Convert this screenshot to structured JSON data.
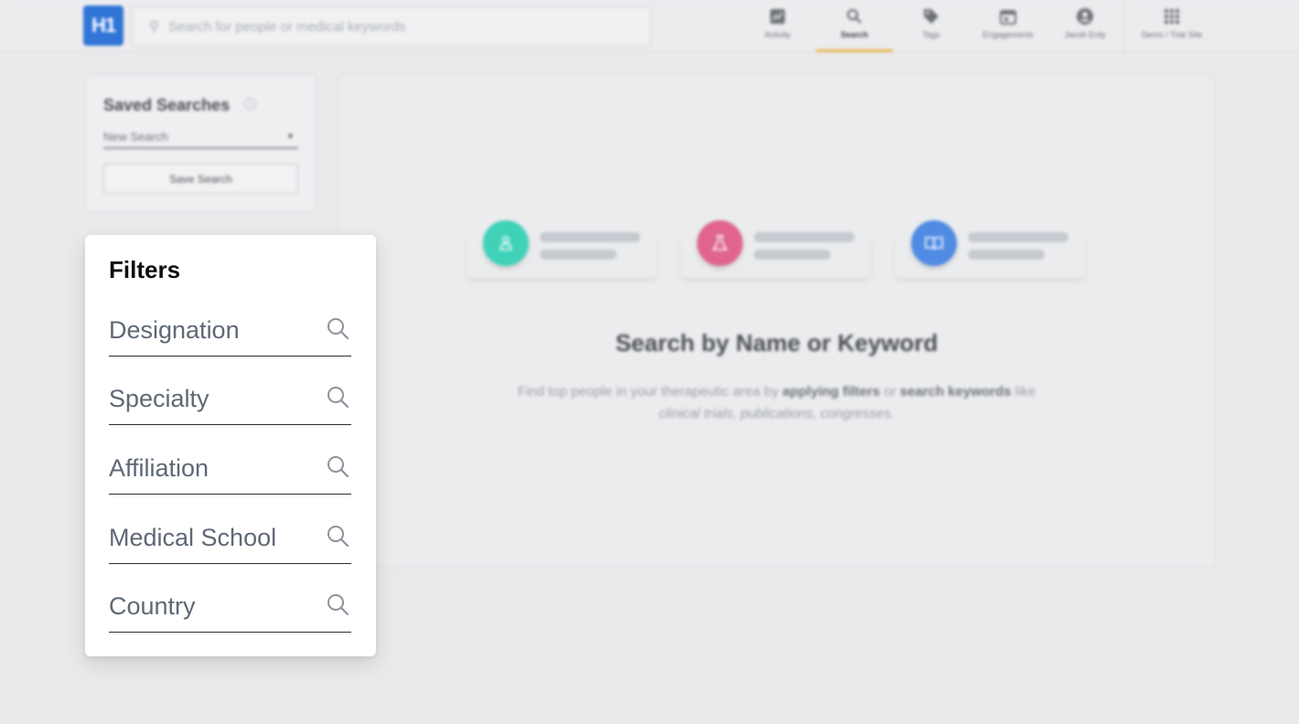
{
  "app": {
    "logo_text": "H1",
    "brand_color": "#2f74d6"
  },
  "search": {
    "placeholder": "Search for people or medical keywords"
  },
  "nav": {
    "items": [
      {
        "label": "Activity",
        "icon": "activity-icon"
      },
      {
        "label": "Search",
        "icon": "search-icon",
        "active": true
      },
      {
        "label": "Tags",
        "icon": "tag-icon"
      },
      {
        "label": "Engagements",
        "icon": "calendar-icon"
      },
      {
        "label": "Jacob Erdy",
        "icon": "account-icon"
      },
      {
        "label": "Demo / Trial Site",
        "icon": "apps-grid-icon"
      }
    ],
    "active_indicator_color": "#e8b44a"
  },
  "saved_searches": {
    "title": "Saved Searches",
    "selected": "New Search",
    "save_button": "Save Search"
  },
  "empty_state": {
    "title": "Search by Name or Keyword",
    "desc_prefix": "Find top people in your therapeutic area by ",
    "desc_bold1": "applying filters",
    "desc_mid": " or ",
    "desc_bold2": "search keywords",
    "desc_suffix": " like",
    "desc_line2": "clinical trials, publications, congresses.",
    "cards": [
      {
        "icon": "person-icon",
        "color": "#3fd2b9"
      },
      {
        "icon": "flask-icon",
        "color": "#e0648e"
      },
      {
        "icon": "book-icon",
        "color": "#4f8be3"
      }
    ]
  },
  "filters": {
    "title": "Filters",
    "items": [
      {
        "label": "Designation"
      },
      {
        "label": "Specialty"
      },
      {
        "label": "Affiliation"
      },
      {
        "label": "Medical School"
      },
      {
        "label": "Country"
      }
    ]
  }
}
